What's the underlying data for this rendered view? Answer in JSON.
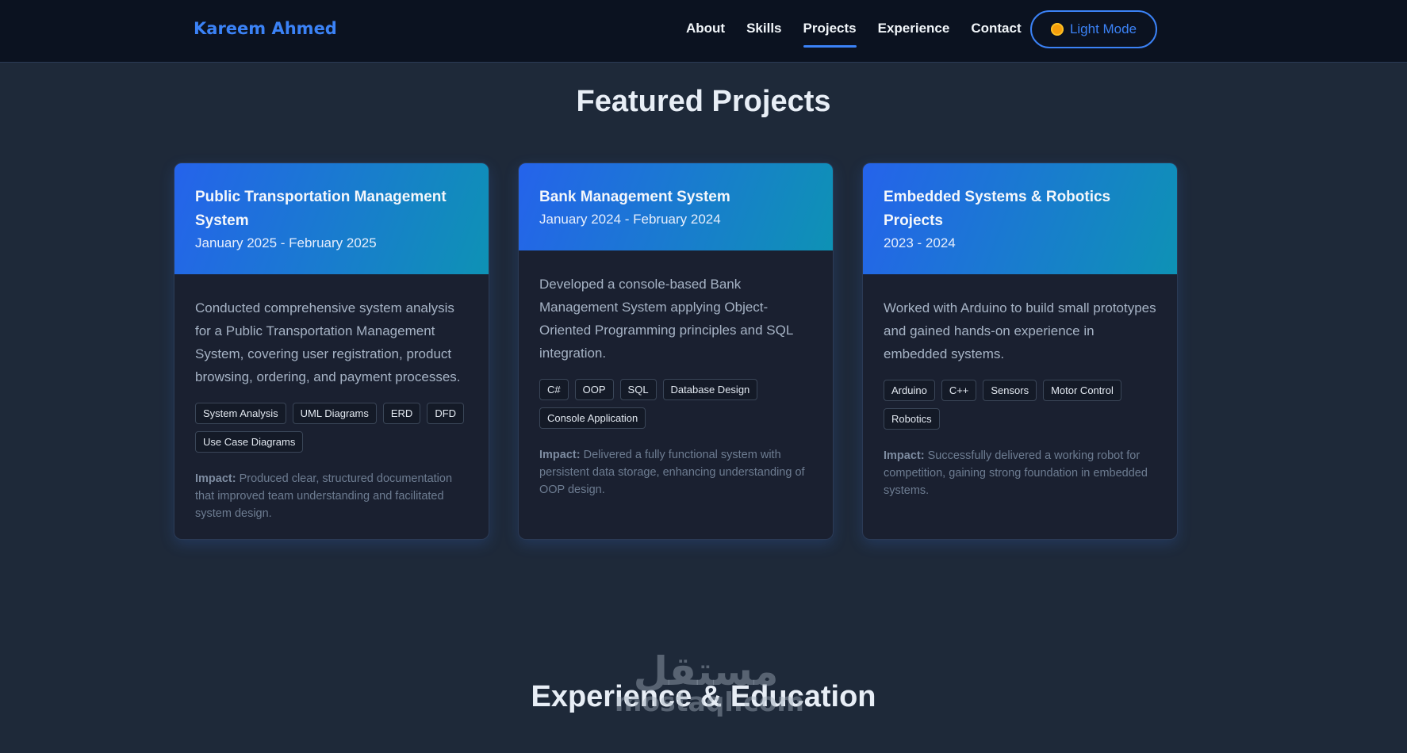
{
  "nav": {
    "brand": "Kareem Ahmed",
    "links": [
      "About",
      "Skills",
      "Projects",
      "Experience",
      "Contact"
    ],
    "active": "Projects",
    "theme_toggle": "Light Mode"
  },
  "sections": {
    "projects_title": "Featured Projects",
    "experience_title": "Experience & Education"
  },
  "projects": [
    {
      "title": "Public Transportation Management System",
      "date": "January 2025 - February 2025",
      "description": "Conducted comprehensive system analysis for a Public Transportation Management System, covering user registration, product browsing, ordering, and payment processes.",
      "tags": [
        "System Analysis",
        "UML Diagrams",
        "ERD",
        "DFD",
        "Use Case Diagrams"
      ],
      "impact_label": "Impact:",
      "impact": "Produced clear, structured documentation that improved team understanding and facilitated system design."
    },
    {
      "title": "Bank Management System",
      "date": "January 2024 - February 2024",
      "description": "Developed a console-based Bank Management System applying Object-Oriented Programming principles and SQL integration.",
      "tags": [
        "C#",
        "OOP",
        "SQL",
        "Database Design",
        "Console Application"
      ],
      "impact_label": "Impact:",
      "impact": "Delivered a fully functional system with persistent data storage, enhancing understanding of OOP design."
    },
    {
      "title": "Embedded Systems & Robotics Projects",
      "date": "2023 - 2024",
      "description": "Worked with Arduino to build small prototypes and gained hands-on experience in embedded systems.",
      "tags": [
        "Arduino",
        "C++",
        "Sensors",
        "Motor Control",
        "Robotics"
      ],
      "impact_label": "Impact:",
      "impact": "Successfully delivered a working robot for competition, gaining strong foundation in embedded systems."
    }
  ],
  "watermark": {
    "arabic": "مستقل",
    "latin": "mostaql.com"
  },
  "colors": {
    "page_bg": "#1e2939",
    "nav_bg": "#0b1220",
    "accent": "#3b82f6",
    "card_bg": "#1a2030",
    "card_header_from": "#2563eb",
    "card_header_to": "#0e92b5"
  },
  "icons": {
    "theme_toggle": "sun-icon"
  }
}
